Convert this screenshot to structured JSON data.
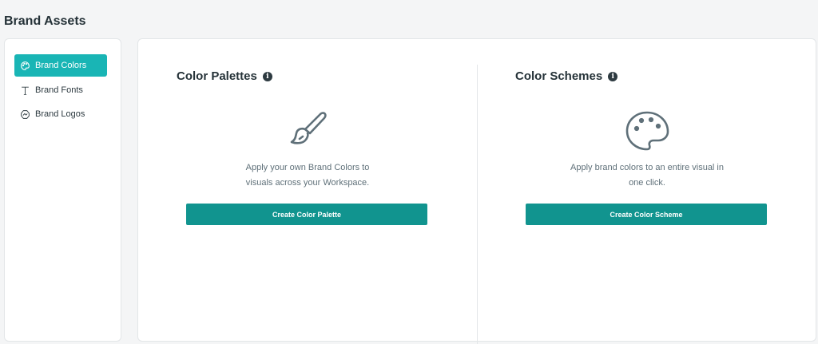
{
  "page": {
    "title": "Brand Assets"
  },
  "sidebar": {
    "items": [
      {
        "label": "Brand Colors",
        "icon": "palette-icon",
        "active": true
      },
      {
        "label": "Brand Fonts",
        "icon": "text-icon",
        "active": false
      },
      {
        "label": "Brand Logos",
        "icon": "logo-icon",
        "active": false
      }
    ]
  },
  "palettes": {
    "title": "Color Palettes",
    "info": "i",
    "illustration": "paintbrush-icon",
    "description_line1": "Apply your own Brand Colors to",
    "description_line2": "visuals across your Workspace.",
    "button_label": "Create Color Palette"
  },
  "schemes": {
    "title": "Color Schemes",
    "info": "i",
    "illustration": "palette-icon",
    "description_line1": "Apply brand colors to an entire visual in",
    "description_line2": "one click.",
    "button_label": "Create Color Scheme"
  },
  "colors": {
    "accent_active": "#19b5b5",
    "button": "#11948f",
    "icon_stroke": "#5f7079"
  }
}
